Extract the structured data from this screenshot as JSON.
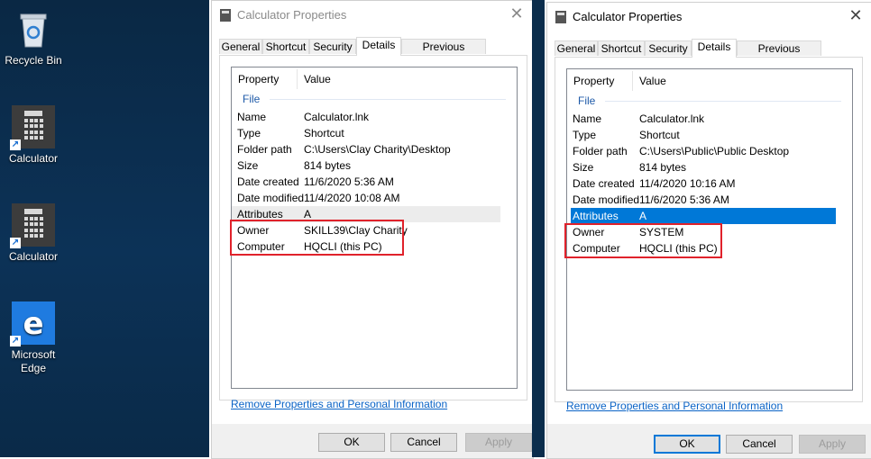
{
  "desktop": {
    "icons": [
      {
        "label": "Recycle Bin",
        "icon": "recycle-bin-icon"
      },
      {
        "label": "Calculator",
        "icon": "calculator-icon"
      },
      {
        "label": "Calculator",
        "icon": "calculator-icon"
      },
      {
        "label": "Microsoft Edge",
        "icon": "edge-icon"
      }
    ]
  },
  "dialogs": [
    {
      "title": "Calculator Properties",
      "state": "inactive",
      "tabs": [
        "General",
        "Shortcut",
        "Security",
        "Details",
        "Previous Versions"
      ],
      "active_tab": "Details",
      "columns": {
        "property": "Property",
        "value": "Value"
      },
      "group": "File",
      "rows": [
        {
          "key": "Name",
          "value": "Calculator.lnk"
        },
        {
          "key": "Type",
          "value": "Shortcut"
        },
        {
          "key": "Folder path",
          "value": "C:\\Users\\Clay Charity\\Desktop"
        },
        {
          "key": "Size",
          "value": "814 bytes"
        },
        {
          "key": "Date created",
          "value": "11/6/2020 5:36 AM"
        },
        {
          "key": "Date modified",
          "value": "11/4/2020 10:08 AM"
        },
        {
          "key": "Attributes",
          "value": "A"
        },
        {
          "key": "Owner",
          "value": "SKILL39\\Clay Charity"
        },
        {
          "key": "Computer",
          "value": "HQCLI (this PC)"
        }
      ],
      "highlighted_row": "Attributes",
      "link": "Remove Properties and Personal Information",
      "buttons": {
        "ok": "OK",
        "cancel": "Cancel",
        "apply": "Apply"
      }
    },
    {
      "title": "Calculator Properties",
      "state": "active",
      "tabs": [
        "General",
        "Shortcut",
        "Security",
        "Details",
        "Previous Versions"
      ],
      "active_tab": "Details",
      "columns": {
        "property": "Property",
        "value": "Value"
      },
      "group": "File",
      "rows": [
        {
          "key": "Name",
          "value": "Calculator.lnk"
        },
        {
          "key": "Type",
          "value": "Shortcut"
        },
        {
          "key": "Folder path",
          "value": "C:\\Users\\Public\\Public Desktop"
        },
        {
          "key": "Size",
          "value": "814 bytes"
        },
        {
          "key": "Date created",
          "value": "11/4/2020 10:16 AM"
        },
        {
          "key": "Date modified",
          "value": "11/6/2020 5:36 AM"
        },
        {
          "key": "Attributes",
          "value": "A"
        },
        {
          "key": "Owner",
          "value": "SYSTEM"
        },
        {
          "key": "Computer",
          "value": "HQCLI (this PC)"
        }
      ],
      "highlighted_row": "Attributes",
      "link": "Remove Properties and Personal Information",
      "buttons": {
        "ok": "OK",
        "cancel": "Cancel",
        "apply": "Apply"
      }
    }
  ],
  "colors": {
    "annotation_box": "#e0222b",
    "selection": "#0078d7",
    "link": "#0a63c6",
    "desktop": "#0c3257"
  }
}
